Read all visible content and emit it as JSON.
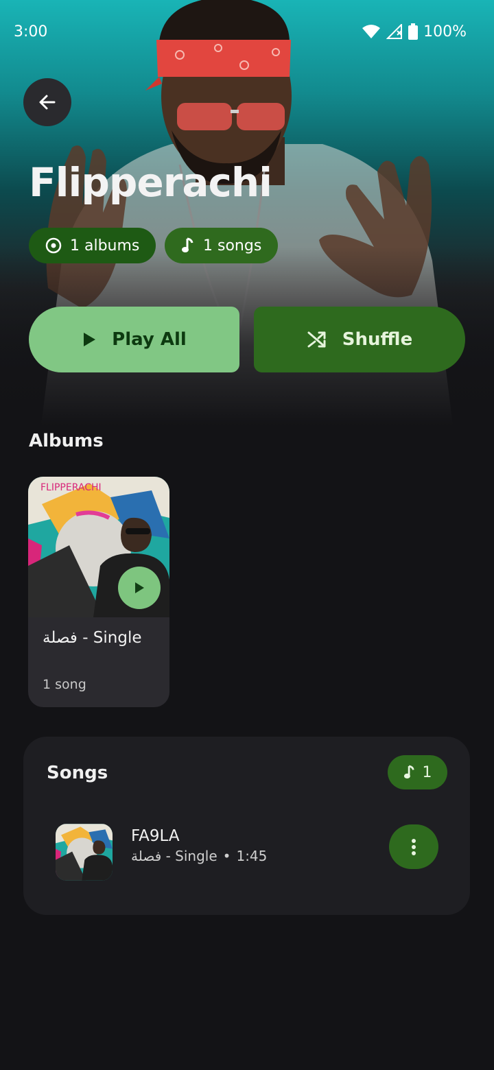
{
  "status_bar": {
    "time": "3:00",
    "battery": "100%",
    "icons": [
      "wifi-icon",
      "signal-icon",
      "battery-icon"
    ]
  },
  "header": {
    "back_icon": "arrow-left-icon",
    "artist_name": "Flipperachi",
    "albums_chip": "1 albums",
    "songs_chip": "1 songs"
  },
  "actions": {
    "play_all": "Play All",
    "shuffle": "Shuffle"
  },
  "albums": {
    "title": "Albums",
    "items": [
      {
        "title": "فصلة - Single",
        "count": "1 song",
        "cover_text": "FLIPPERACHI"
      }
    ]
  },
  "songs": {
    "title": "Songs",
    "count": "1",
    "items": [
      {
        "title": "FA9LA",
        "album": "فصلة - Single",
        "separator": "•",
        "duration": "1:45"
      }
    ]
  },
  "colors": {
    "background": "#131316",
    "accent_light": "#81c784",
    "accent_dark": "#2e6a1e",
    "hero_teal": "#19b4b6"
  }
}
